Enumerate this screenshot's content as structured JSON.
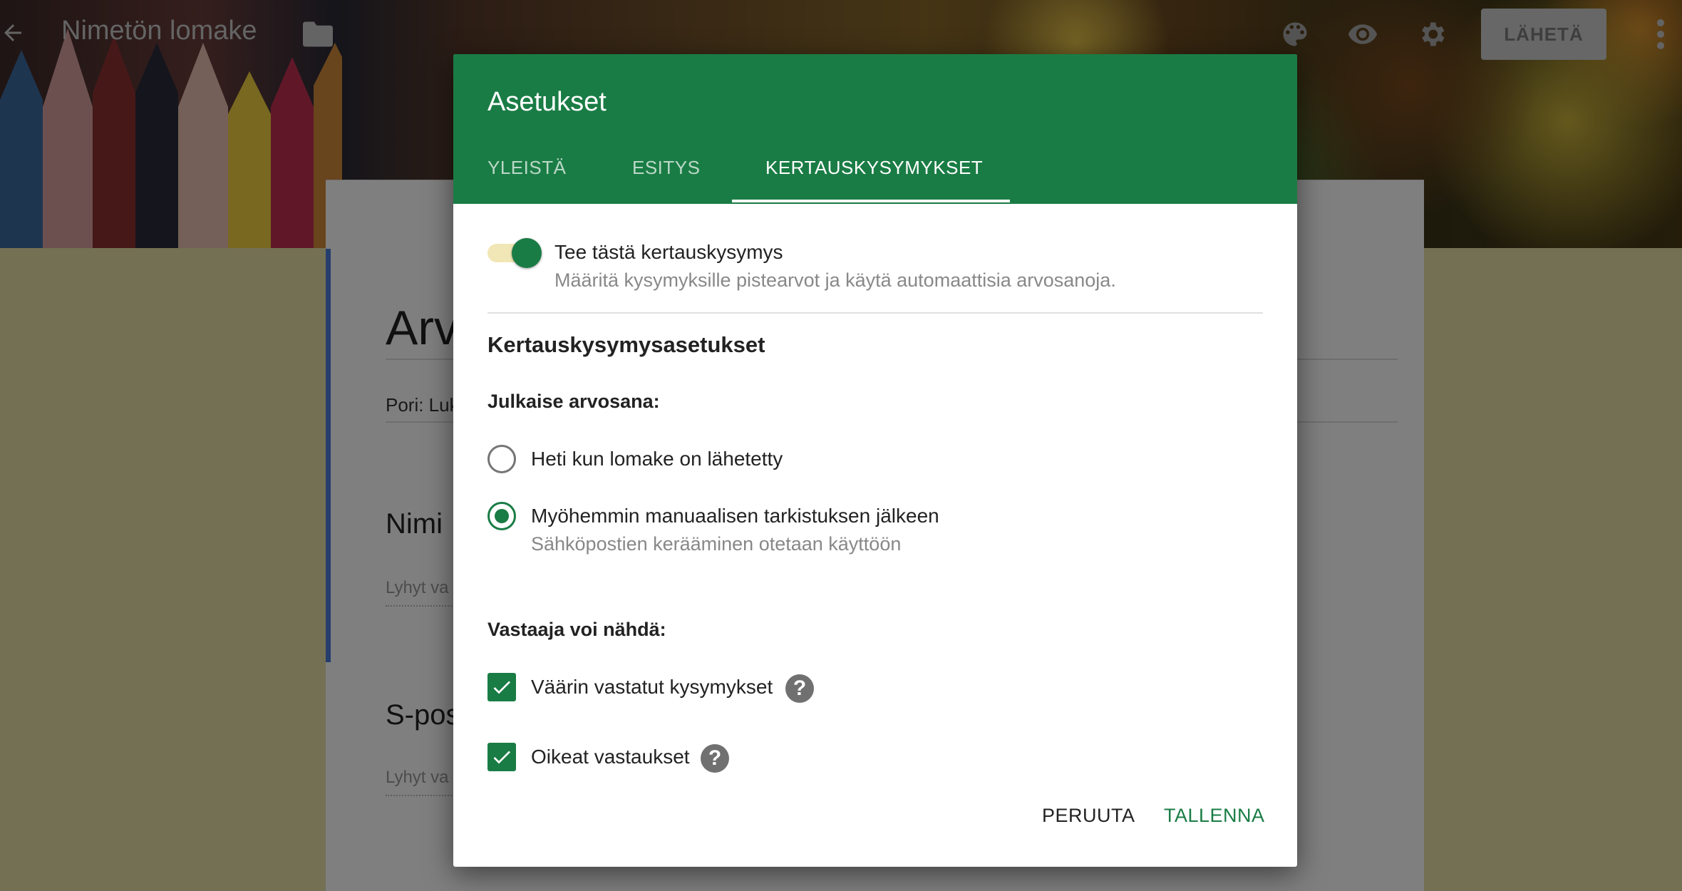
{
  "app": {
    "form_title": "Nimetön lomake",
    "send_label": "LÄHETÄ",
    "icons": {
      "back": "arrow-left-icon",
      "folder": "folder-icon",
      "palette": "palette-icon",
      "preview": "eye-icon",
      "settings": "gear-icon",
      "more": "more-vert-icon"
    }
  },
  "form": {
    "title": "Arv",
    "description": "Pori: Luk",
    "questions": [
      {
        "label": "Nimi",
        "hint": "Lyhyt va"
      },
      {
        "label": "S-pos",
        "hint": "Lyhyt va"
      }
    ]
  },
  "dialog": {
    "title": "Asetukset",
    "tabs": [
      {
        "label": "YLEISTÄ",
        "active": false
      },
      {
        "label": "ESITYS",
        "active": false
      },
      {
        "label": "KERTAUSKYSYMYKSET",
        "active": true
      }
    ],
    "quiz_toggle": {
      "label": "Tee tästä kertauskysymys",
      "description": "Määritä kysymyksille pistearvot ja käytä automaattisia arvosanoja.",
      "on": true
    },
    "section_title": "Kertauskysymysasetukset",
    "release_grade": {
      "heading": "Julkaise arvosana:",
      "options": [
        {
          "label": "Heti kun lomake on lähetetty",
          "checked": false
        },
        {
          "label": "Myöhemmin manuaalisen tarkistuksen jälkeen",
          "sub": "Sähköpostien kerääminen otetaan käyttöön",
          "checked": true
        }
      ]
    },
    "respondent_can_see": {
      "heading": "Vastaaja voi nähdä:",
      "options": [
        {
          "label": "Väärin vastatut kysymykset",
          "checked": true
        },
        {
          "label": "Oikeat vastaukset",
          "checked": true
        }
      ]
    },
    "buttons": {
      "cancel": "PERUUTA",
      "save": "TALLENNA"
    }
  },
  "colors": {
    "accent_green": "#1a7c45",
    "page_background": "#e6e1a8",
    "toggle_track": "#f1e7b6"
  }
}
